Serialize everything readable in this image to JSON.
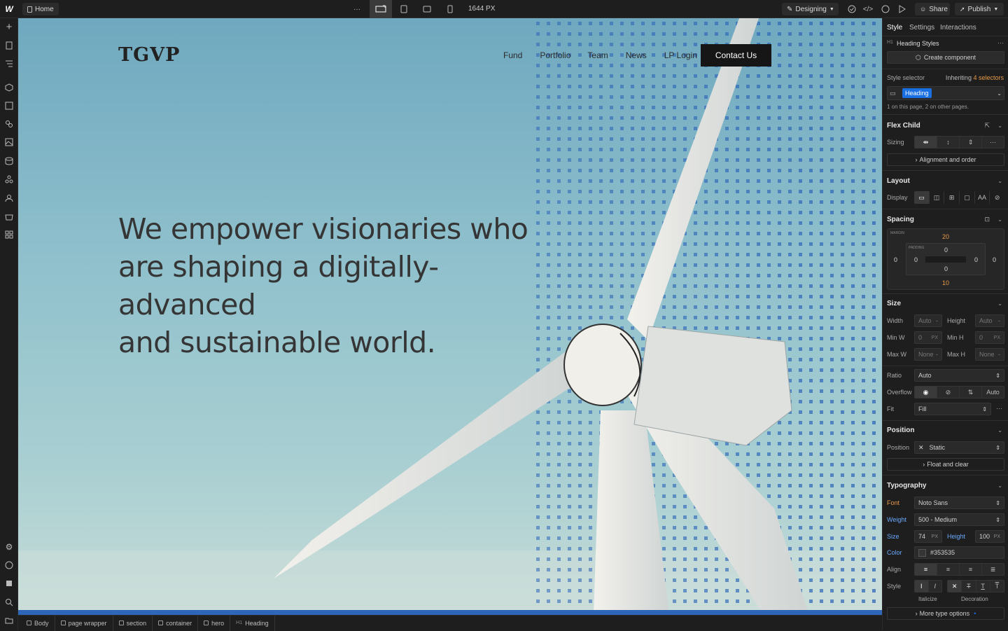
{
  "topbar": {
    "page_name": "Home",
    "more": "···",
    "width_px": "1644 PX",
    "mode": "Designing",
    "share": "Share",
    "publish": "Publish"
  },
  "site": {
    "logo": "TGVP",
    "nav": [
      "Fund",
      "Portfolio",
      "Team",
      "News",
      "LP Login"
    ],
    "cta": "Contact Us",
    "headline": [
      "We empower visionaries who",
      "are shaping a digitally-advanced",
      "and sustainable world."
    ]
  },
  "panel": {
    "tabs": [
      "Style",
      "Settings",
      "Interactions"
    ],
    "element_name": "Heading Styles",
    "create_component": "Create component",
    "style_selector_label": "Style selector",
    "inheriting_prefix": "Inheriting",
    "inheriting_count": "4 selectors",
    "selector_chip": "Heading",
    "selector_note": "1 on this page, 2 on other pages.",
    "flex_child": {
      "title": "Flex Child",
      "sizing_label": "Sizing",
      "alignment": "Alignment and order"
    },
    "layout": {
      "title": "Layout",
      "display_label": "Display",
      "aa": "AA"
    },
    "spacing": {
      "title": "Spacing",
      "margin_label": "MARGIN",
      "padding_label": "PADDING",
      "margin_top": "20",
      "margin_right": "0",
      "margin_bottom": "10",
      "margin_left": "0",
      "padding_top": "0",
      "padding_right": "0",
      "padding_bottom": "0",
      "padding_left": "0"
    },
    "size": {
      "title": "Size",
      "width_label": "Width",
      "width_val": "Auto",
      "height_label": "Height",
      "height_val": "Auto",
      "minw_label": "Min W",
      "minw_val": "0",
      "minw_unit": "PX",
      "minh_label": "Min H",
      "minh_val": "0",
      "minh_unit": "PX",
      "maxw_label": "Max W",
      "maxw_val": "None",
      "maxh_label": "Max H",
      "maxh_val": "None",
      "dash": "-",
      "ratio_label": "Ratio",
      "ratio_val": "Auto",
      "overflow_label": "Overflow",
      "overflow_auto": "Auto",
      "fit_label": "Fit",
      "fit_val": "Fill"
    },
    "position": {
      "title": "Position",
      "label": "Position",
      "value": "Static",
      "float": "Float and clear"
    },
    "typography": {
      "title": "Typography",
      "font_label": "Font",
      "font_val": "Noto Sans",
      "weight_label": "Weight",
      "weight_val": "500 - Medium",
      "size_label": "Size",
      "size_val": "74",
      "size_unit": "PX",
      "height_label": "Height",
      "height_val": "100",
      "height_unit": "PX",
      "color_label": "Color",
      "color_val": "#353535",
      "align_label": "Align",
      "style_label": "Style",
      "italicize": "Italicize",
      "decoration": "Decoration",
      "more": "More type options"
    }
  },
  "breadcrumbs": [
    "Body",
    "page wrapper",
    "section",
    "container",
    "hero",
    "Heading"
  ],
  "colors": {
    "accent": "#1a6fe0",
    "heading_text": "#353535",
    "panel_bg": "#1e1e1e"
  }
}
